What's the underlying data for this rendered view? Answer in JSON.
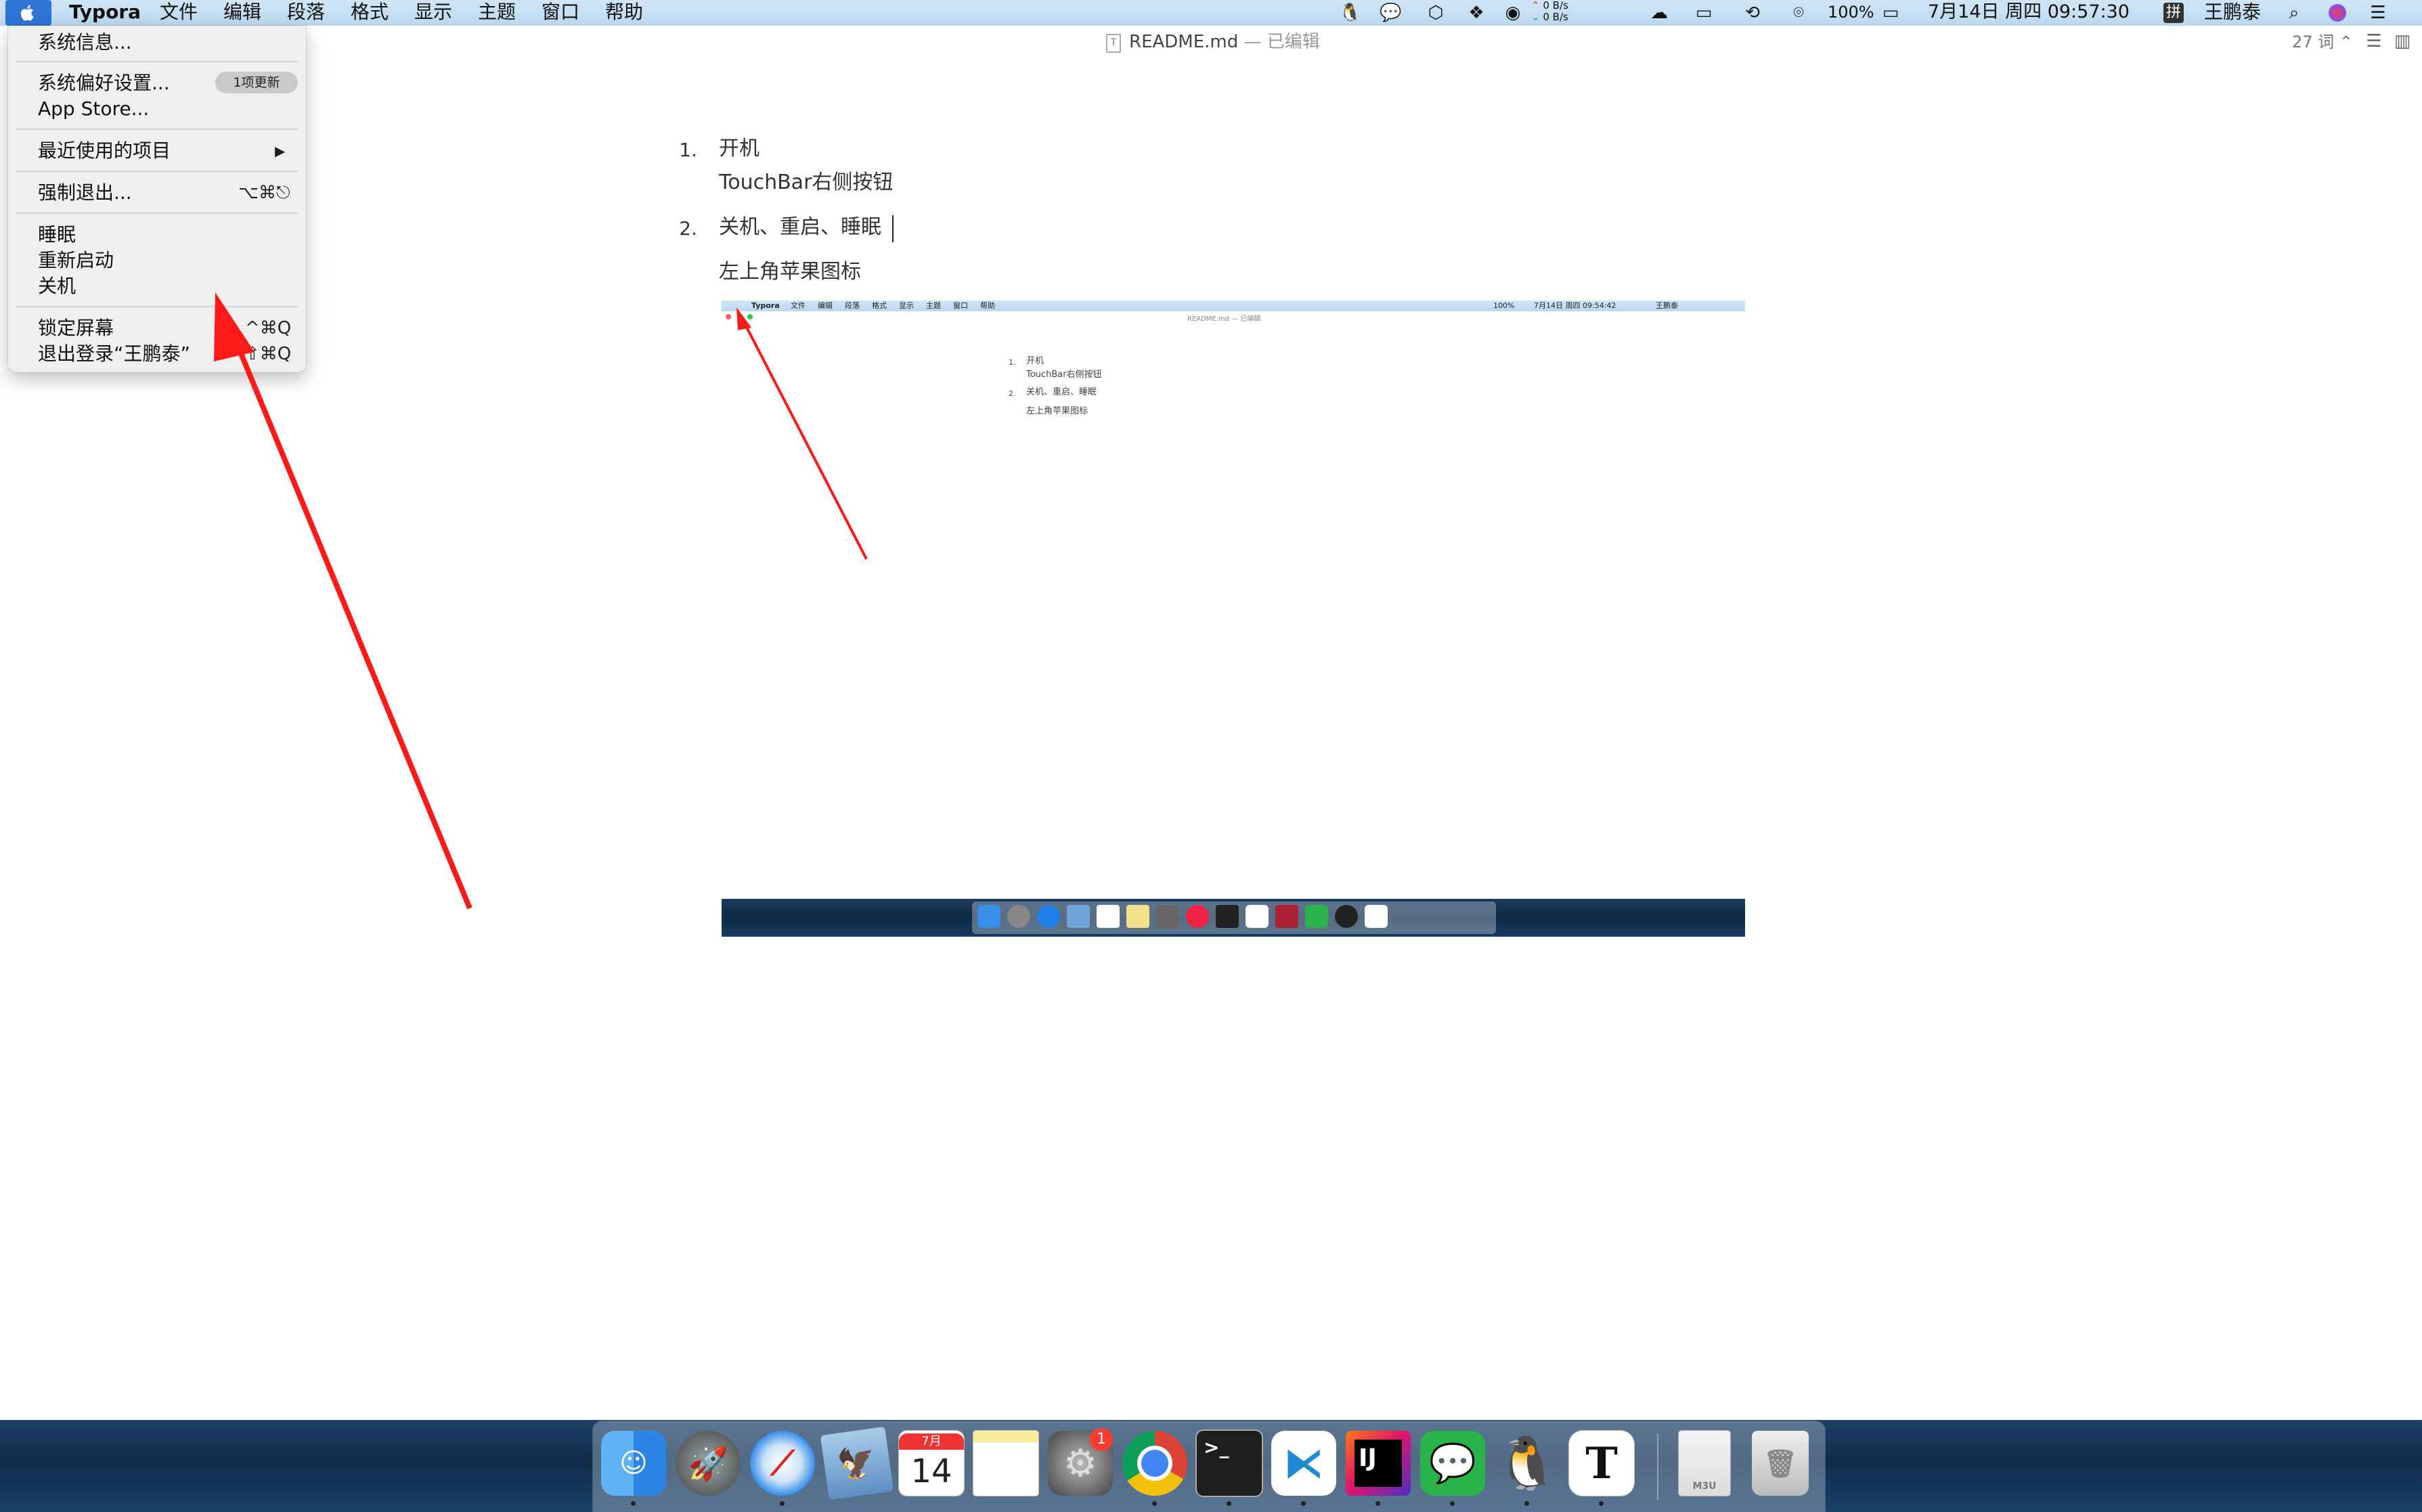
{
  "menubar": {
    "app_name": "Typora",
    "menus": [
      "文件",
      "编辑",
      "段落",
      "格式",
      "显示",
      "主题",
      "窗口",
      "帮助"
    ],
    "net_up": "0 B/s",
    "net_down": "0 B/s",
    "battery": "100%",
    "datetime": "7月14日 周四 09:57:30",
    "input_method": "拼",
    "user": "王鹏泰"
  },
  "titlebar": {
    "filename": "README.md",
    "status": "— 已编辑",
    "word_count": "27 词"
  },
  "apple_menu": {
    "about": "系统信息...",
    "prefs": "系统偏好设置...",
    "prefs_badge": "1项更新",
    "app_store": "App Store...",
    "recent": "最近使用的项目",
    "recent_arrow": "▶",
    "force_quit": "强制退出...",
    "force_quit_shortcut": "⌥⌘⎋",
    "sleep": "睡眠",
    "restart": "重新启动",
    "shutdown": "关机",
    "lock": "锁定屏幕",
    "lock_shortcut": "^⌘Q",
    "logout": "退出登录“王鹏泰”",
    "logout_shortcut": "⇧⌘Q"
  },
  "document": {
    "item1_num": "1.",
    "item1_title": "开机",
    "item1_body": "TouchBar右侧按钮",
    "item2_num": "2.",
    "item2_title": "关机、重启、睡眠",
    "item2_body": "左上角苹果图标"
  },
  "embedded": {
    "app_name": "Typora",
    "menus": [
      "文件",
      "编辑",
      "段落",
      "格式",
      "显示",
      "主题",
      "窗口",
      "帮助"
    ],
    "datetime": "7月14日 周四 09:54:42",
    "user": "王鹏泰",
    "battery": "100%",
    "title": "README.md — 已编辑",
    "item1_num": "1.",
    "item1_title": "开机",
    "item1_body": "TouchBar右侧按钮",
    "item2_num": "2.",
    "item2_title": "关机、重启、睡眠",
    "item2_body": "左上角苹果图标"
  },
  "dock": {
    "calendar_month": "7月",
    "calendar_day": "14",
    "prefs_badge": "1",
    "intellij_label": "IJ",
    "typora_label": "T",
    "file_label": "M3U",
    "terminal_prompt": ">_"
  },
  "colors": {
    "accent": "#2f74d6",
    "annotation_arrow": "#ff1a1a",
    "badge": "#ff3b30"
  },
  "icons": [
    "apple-icon",
    "qq-icon",
    "wechat-icon",
    "box-icon",
    "bookmark-icon",
    "shield-icon",
    "cloud-icon",
    "airplay-icon",
    "time-machine-icon",
    "sync-icon",
    "battery-icon",
    "search-icon",
    "siri-icon",
    "control-center-icon",
    "document-icon",
    "outline-icon",
    "sidebar-icon"
  ]
}
